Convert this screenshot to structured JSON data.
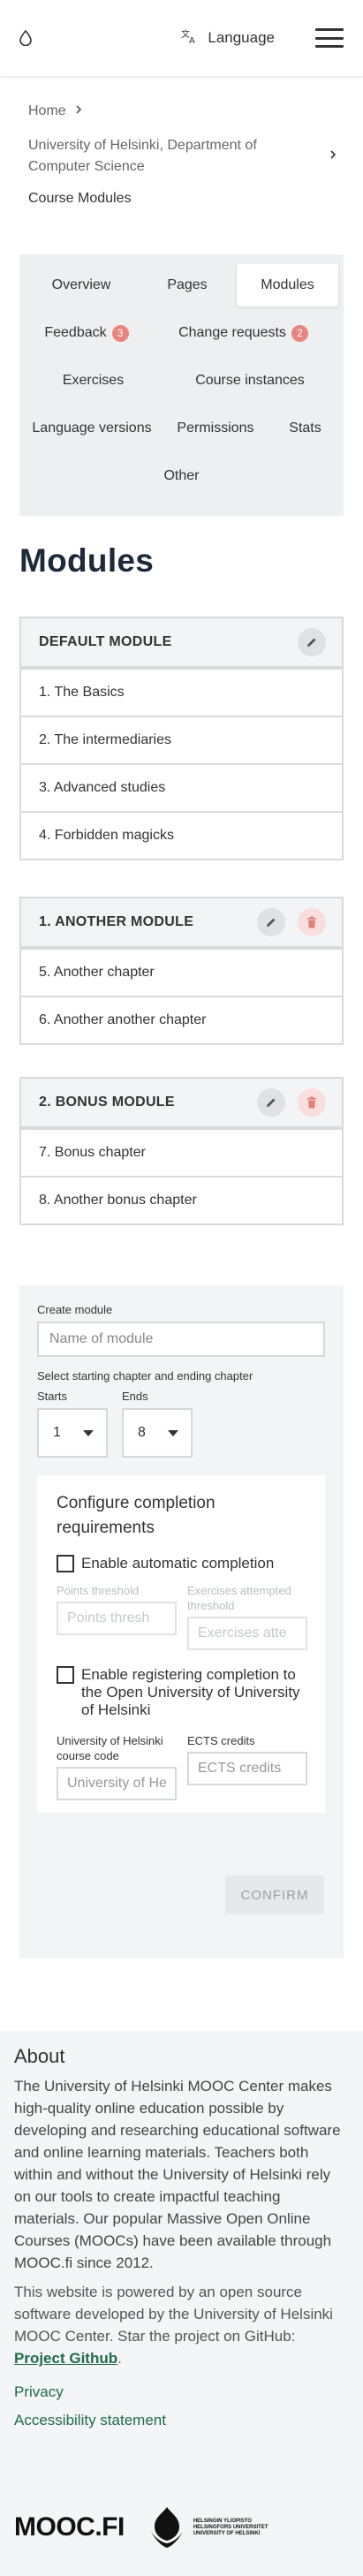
{
  "topbar": {
    "language_label": "Language"
  },
  "breadcrumbs": {
    "home": "Home",
    "department": "University of Helsinki, Department of Computer Science",
    "current": "Course Modules"
  },
  "tabs": {
    "overview": "Overview",
    "pages": "Pages",
    "modules": "Modules",
    "feedback": "Feedback",
    "feedback_count": "3",
    "change_requests": "Change requests",
    "change_requests_count": "2",
    "exercises": "Exercises",
    "course_instances": "Course instances",
    "language_versions": "Language versions",
    "permissions": "Permissions",
    "stats": "Stats",
    "other": "Other"
  },
  "page_title": "Modules",
  "modules": [
    {
      "title": "DEFAULT MODULE",
      "chapters": [
        "1. The Basics",
        "2. The intermediaries",
        "3. Advanced studies",
        "4. Forbidden magicks"
      ]
    },
    {
      "title": "1. ANOTHER MODULE",
      "chapters": [
        "5. Another chapter",
        "6. Another another chapter"
      ]
    },
    {
      "title": "2. BONUS MODULE",
      "chapters": [
        "7. Bonus chapter",
        "8. Another bonus chapter"
      ]
    }
  ],
  "create_form": {
    "create_label": "Create module",
    "name_placeholder": "Name of module",
    "range_label": "Select starting chapter and ending chapter",
    "starts_label": "Starts",
    "starts_value": "1",
    "ends_label": "Ends",
    "ends_value": "8",
    "requirements_title": "Configure completion requirements",
    "auto_completion_label": "Enable automatic completion",
    "points_threshold_label": "Points threshold",
    "points_threshold_placeholder": "Points thresh",
    "exercises_threshold_label": "Exercises attempted threshold",
    "exercises_threshold_placeholder": "Exercises atte",
    "open_uni_label": "Enable registering completion to the Open University of University of Helsinki",
    "course_code_label": "University of Helsinki course code",
    "course_code_placeholder": "University of He",
    "ects_label": "ECTS credits",
    "ects_placeholder": "ECTS credits",
    "confirm_label": "CONFIRM"
  },
  "footer": {
    "about_title": "About",
    "about_text": "The University of Helsinki MOOC Center makes high-quality online education possible by developing and researching educational software and online learning materials. Teachers both within and without the University of Helsinki rely on our tools to create impactful teaching materials. Our popular Massive Open Online Courses (MOOCs) have been available through MOOC.fi since 2012.",
    "powered_text": "This website is powered by an open source software developed by the University of Helsinki MOOC Center. Star the project on GitHub: ",
    "github_link": "Project Github",
    "powered_end": ".",
    "privacy": "Privacy",
    "accessibility": "Accessibility statement",
    "mooc_logo": "MOOC.FI",
    "hy_line1": "HELSINGIN YLIOPISTO",
    "hy_line2": "HELSINGFORS UNIVERSITET",
    "hy_line3": "UNIVERSITY OF HELSINKI"
  }
}
